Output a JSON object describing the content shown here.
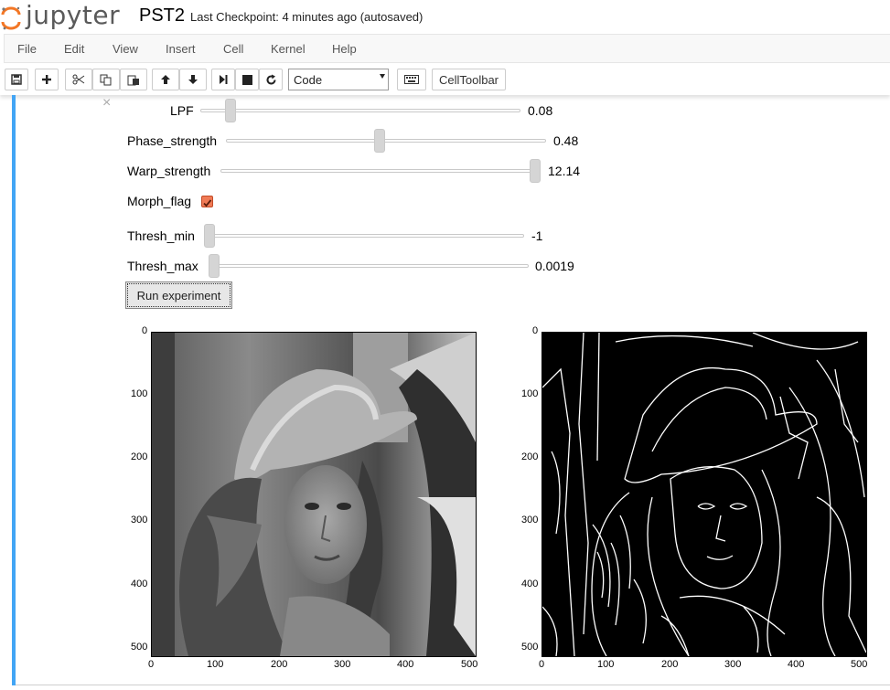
{
  "header": {
    "logo_text": "jupyter",
    "notebook_name": "PST2",
    "checkpoint": "Last Checkpoint: 4 minutes ago (autosaved)"
  },
  "menu": [
    "File",
    "Edit",
    "View",
    "Insert",
    "Cell",
    "Kernel",
    "Help"
  ],
  "toolbar": {
    "cell_type": "Code",
    "celltoolbar_label": "CellToolbar"
  },
  "widgets": {
    "lpf": {
      "label": "LPF",
      "value": "0.08",
      "fraction": 0.09
    },
    "phase": {
      "label": "Phase_strength",
      "value": "0.48",
      "fraction": 0.48
    },
    "warp": {
      "label": "Warp_strength",
      "value": "12.14",
      "fraction": 1.0
    },
    "morph": {
      "label": "Morph_flag",
      "checked": true
    },
    "thresh_min": {
      "label": "Thresh_min",
      "value": "-1",
      "fraction": 0.0
    },
    "thresh_max": {
      "label": "Thresh_max",
      "value": "0.0019",
      "fraction": 0.0
    },
    "run_label": "Run experiment"
  },
  "plots": {
    "y_ticks": [
      "0",
      "100",
      "200",
      "300",
      "400",
      "500"
    ],
    "x_ticks": [
      "0",
      "100",
      "200",
      "300",
      "400",
      "500"
    ]
  },
  "colors": {
    "cell_bar": "#42a5f5",
    "checkbox": "#f07a55"
  }
}
